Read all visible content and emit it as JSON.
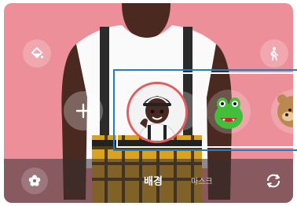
{
  "camera": {
    "modes": [
      {
        "label": "배경",
        "active": true
      },
      {
        "label": "마스크",
        "active": false
      }
    ],
    "icons": {
      "background_edit": "paint-bucket-icon",
      "pose": "person-walking-icon",
      "effects": "flower-icon",
      "switch_camera": "switch-camera-icon",
      "add_left": "plus-icon",
      "add_right": "plus-icon"
    }
  },
  "stickers": [
    {
      "name": "selected-avatar",
      "selected": true
    },
    {
      "name": "green-monster",
      "selected": false
    },
    {
      "name": "brown-bear",
      "selected": false
    }
  ],
  "colors": {
    "background": "#ec8f98",
    "selection_ring": "#e65b5d",
    "highlight_border": "#1d7ec6"
  }
}
